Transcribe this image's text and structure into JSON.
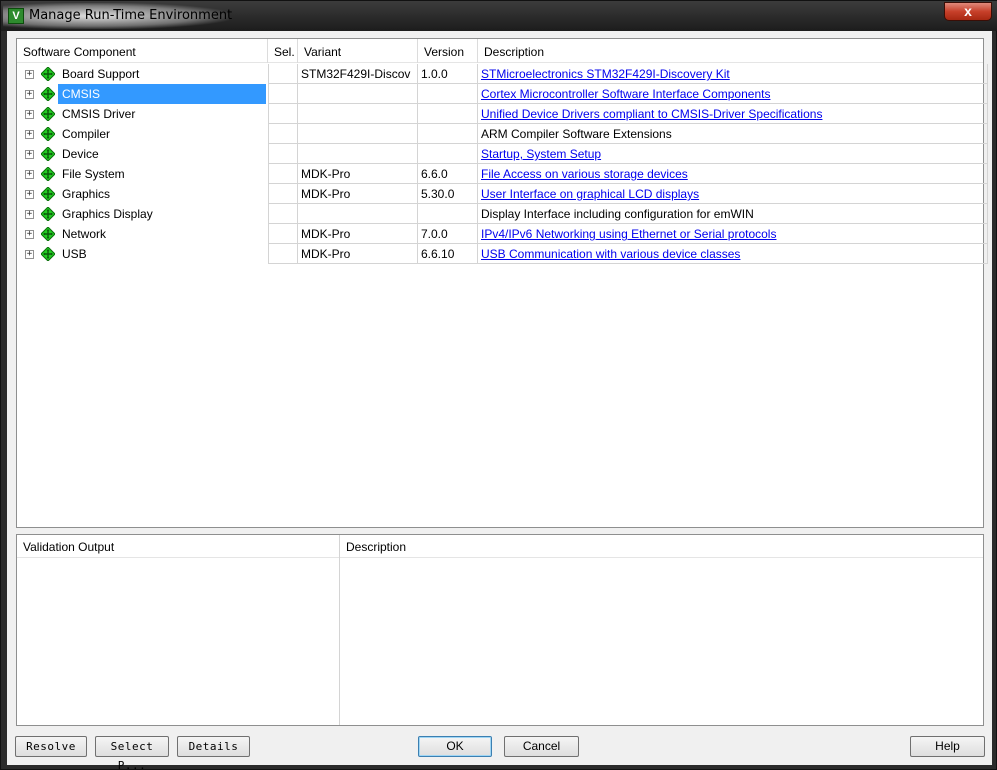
{
  "window": {
    "title": "Manage Run-Time Environment",
    "app_icon_glyph": "V",
    "close_glyph": "x"
  },
  "grid": {
    "headers": {
      "component": "Software Component",
      "sel": "Sel.",
      "variant": "Variant",
      "version": "Version",
      "description": "Description"
    },
    "selected_index": 1,
    "rows": [
      {
        "component": "Board Support",
        "sel": "",
        "variant": "STM32F429I-Discov",
        "has_dropdown": true,
        "version": "1.0.0",
        "description": "STMicroelectronics STM32F429I-Discovery Kit",
        "is_link": true
      },
      {
        "component": "CMSIS",
        "sel": "",
        "variant": "",
        "version": "",
        "description": "Cortex Microcontroller Software Interface Components",
        "is_link": true
      },
      {
        "component": "CMSIS Driver",
        "sel": "",
        "variant": "",
        "version": "",
        "description": "Unified Device Drivers compliant to CMSIS-Driver Specifications",
        "is_link": true
      },
      {
        "component": "Compiler",
        "sel": "",
        "variant": "",
        "version": "",
        "description": "ARM Compiler Software Extensions",
        "is_link": false
      },
      {
        "component": "Device",
        "sel": "",
        "variant": "",
        "version": "",
        "description": "Startup, System Setup",
        "is_link": true
      },
      {
        "component": "File System",
        "sel": "",
        "variant": "MDK-Pro",
        "version": "6.6.0",
        "description": "File Access on various storage devices",
        "is_link": true
      },
      {
        "component": "Graphics",
        "sel": "",
        "variant": "MDK-Pro",
        "version": "5.30.0",
        "description": "User Interface on graphical LCD displays",
        "is_link": true
      },
      {
        "component": "Graphics Display",
        "sel": "",
        "variant": "",
        "version": "",
        "description": "Display Interface including configuration for emWIN",
        "is_link": false
      },
      {
        "component": "Network",
        "sel": "",
        "variant": "MDK-Pro",
        "version": "7.0.0",
        "description": "IPv4/IPv6 Networking using Ethernet or Serial protocols",
        "is_link": true
      },
      {
        "component": "USB",
        "sel": "",
        "variant": "MDK-Pro",
        "version": "6.6.10",
        "description": "USB Communication with various device classes",
        "is_link": true
      }
    ]
  },
  "validation": {
    "output_header": "Validation Output",
    "description_header": "Description"
  },
  "buttons": {
    "resolve": "Resolve",
    "select_packs": "Select P...",
    "details": "Details",
    "ok": "OK",
    "cancel": "Cancel",
    "help": "Help"
  },
  "colors": {
    "selection": "#3399ff",
    "link": "#0000ee",
    "diamond": "#22cc22"
  }
}
